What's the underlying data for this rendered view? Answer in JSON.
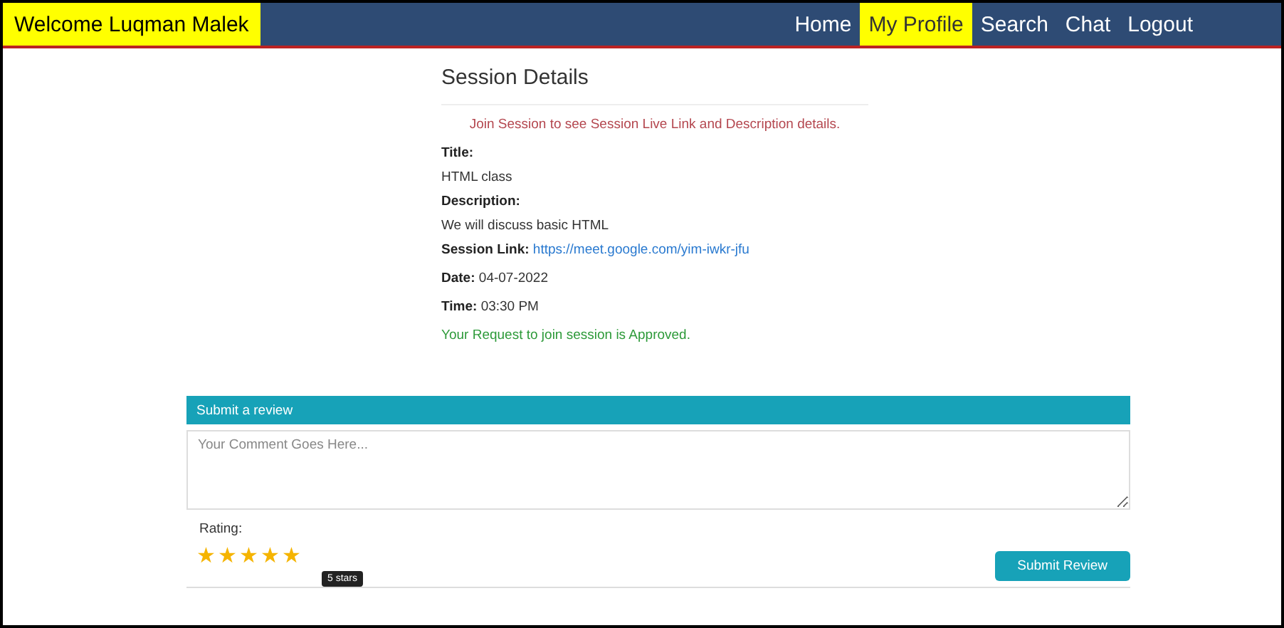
{
  "navbar": {
    "welcome": "Welcome Luqman Malek",
    "links": [
      {
        "label": "Home",
        "selected": false
      },
      {
        "label": "My Profile",
        "selected": true
      },
      {
        "label": "Search",
        "selected": false
      },
      {
        "label": "Chat",
        "selected": false
      },
      {
        "label": "Logout",
        "selected": false
      }
    ]
  },
  "session": {
    "heading": "Session Details",
    "notice": "Join Session to see Session Live Link and Description details.",
    "fields": [
      {
        "kind": "stacked",
        "label": "Title:",
        "value": "HTML class"
      },
      {
        "kind": "stacked",
        "label": "Description:",
        "value": "We will discuss basic HTML"
      },
      {
        "kind": "link",
        "label": "Session Link:",
        "value": "https://meet.google.com/yim-iwkr-jfu"
      },
      {
        "kind": "inline",
        "label": "Date:",
        "value": "04-07-2022"
      },
      {
        "kind": "inline",
        "label": "Time:",
        "value": "03:30 PM"
      }
    ],
    "status": "Your Request to join session is Approved."
  },
  "review": {
    "title": "Submit a review",
    "comment": {
      "placeholder": "Your Comment Goes Here..."
    },
    "rating_label": "Rating:",
    "stars": 5,
    "tooltip": "5 stars",
    "submit": "Submit Review"
  }
}
